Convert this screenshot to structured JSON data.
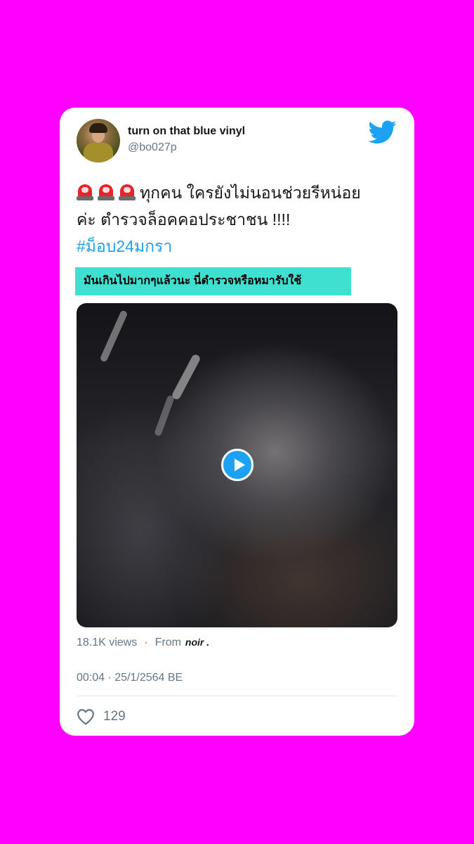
{
  "tweet": {
    "display_name": "turn on that blue vinyl",
    "handle": "@bo027p",
    "text_line1": "ทุกคน ใครยังไม่นอนช่วยรีหน่อย",
    "text_line2": "ค่ะ ตำรวจล็อคคอประชาชน !!!!",
    "hashtag": "#ม็อบ24มกรา",
    "emoji_icons": [
      "police-siren",
      "police-siren",
      "police-siren"
    ],
    "highlight_text": "มันเกินไปมากๆแล้วนะ  นี่ตำรวจหรือหมารับใช้",
    "views": "18.1K views",
    "from_label": "From",
    "source": "noir .",
    "timestamp": "00:04 · 25/1/2564 BE",
    "like_count": "129"
  },
  "colors": {
    "background": "#ff00ff",
    "card": "#ffffff",
    "twitter_blue": "#1da1f2",
    "highlight": "#3fe0cf",
    "muted_text": "#657786"
  },
  "icons": {
    "brand": "twitter-bird-icon",
    "play": "play-icon",
    "like": "heart-icon"
  }
}
